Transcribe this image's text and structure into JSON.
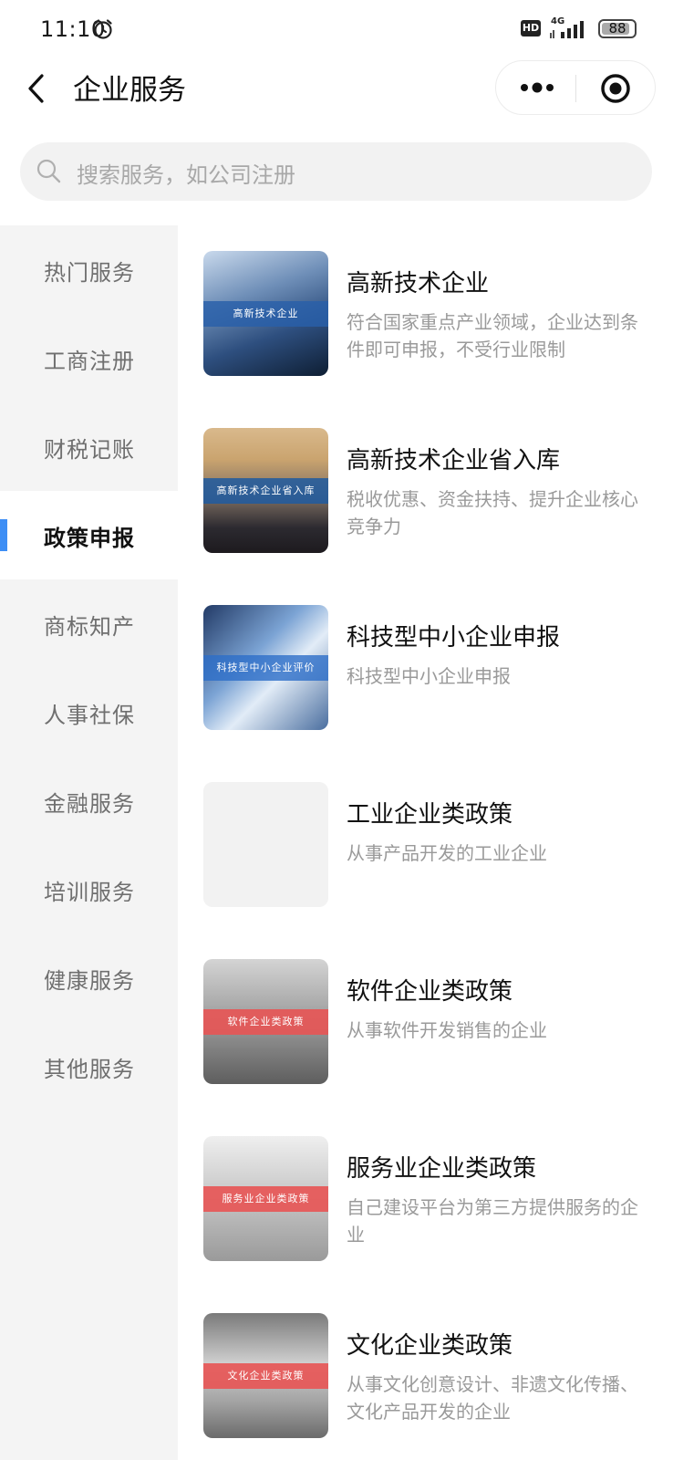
{
  "status_bar": {
    "time": "11:10",
    "network": "4G",
    "battery": "88",
    "hd_label": "HD",
    "icons": [
      "alarm-icon",
      "hd-icon",
      "signal-icon",
      "battery-icon"
    ]
  },
  "nav": {
    "title": "企业服务",
    "icons": [
      "back-icon",
      "more-icon",
      "target-icon"
    ]
  },
  "search": {
    "placeholder": "搜索服务，如公司注册"
  },
  "sidebar": {
    "active_index": 3,
    "accent_color": "#3d8ef5",
    "items": [
      {
        "label": "热门服务"
      },
      {
        "label": "工商注册"
      },
      {
        "label": "财税记账"
      },
      {
        "label": "政策申报"
      },
      {
        "label": "商标知产"
      },
      {
        "label": "人事社保"
      },
      {
        "label": "金融服务"
      },
      {
        "label": "培训服务"
      },
      {
        "label": "健康服务"
      },
      {
        "label": "其他服务"
      }
    ]
  },
  "services": [
    {
      "title": "高新技术企业",
      "desc": "符合国家重点产业领域，企业达到条件即可申报，不受行业限制",
      "thumb_label": "高新技术企业"
    },
    {
      "title": "高新技术企业省入库",
      "desc": "税收优惠、资金扶持、提升企业核心竞争力",
      "thumb_label": "高新技术企业省入库"
    },
    {
      "title": "科技型中小企业申报",
      "desc": "科技型中小企业申报",
      "thumb_label": "科技型中小企业评价"
    },
    {
      "title": "工业企业类政策",
      "desc": "从事产品开发的工业企业",
      "thumb_label": ""
    },
    {
      "title": "软件企业类政策",
      "desc": "从事软件开发销售的企业",
      "thumb_label": "软件企业类政策"
    },
    {
      "title": "服务业企业类政策",
      "desc": "自己建设平台为第三方提供服务的企业",
      "thumb_label": "服务业企业类政策"
    },
    {
      "title": "文化企业类政策",
      "desc": "从事文化创意设计、非遗文化传播、文化产品开发的企业",
      "thumb_label": "文化企业类政策"
    }
  ]
}
